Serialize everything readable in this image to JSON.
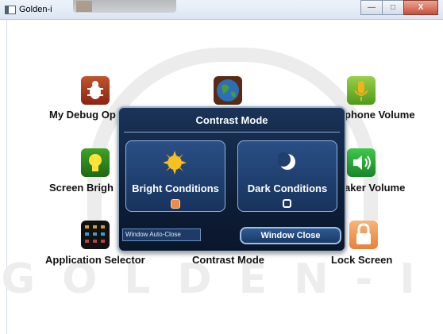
{
  "window": {
    "title": "Golden-i",
    "background_dialog_title": "Contrast Mode"
  },
  "watermark": "GOLDEN-I",
  "tiles": [
    {
      "label": "My Debug Op",
      "icon": "bug-icon"
    },
    {
      "label": "",
      "icon": "globe-icon"
    },
    {
      "label": "phone Volume",
      "icon": "microphone-icon"
    },
    {
      "label": "Screen Brigh",
      "icon": "lightbulb-icon"
    },
    {
      "label": "aker Volume",
      "icon": "speaker-icon"
    },
    {
      "label": "Application Selector",
      "icon": "app-grid-icon"
    },
    {
      "label": "Contrast Mode",
      "icon": "contrast-icon"
    },
    {
      "label": "Lock Screen",
      "icon": "lock-icon"
    }
  ],
  "dialog": {
    "title": "Contrast Mode",
    "options": [
      {
        "label": "Bright Conditions",
        "icon": "sun-icon",
        "selected": true
      },
      {
        "label": "Dark Conditions",
        "icon": "moon-icon",
        "selected": false
      }
    ],
    "auto_close_label": "Window Auto-Close",
    "close_button": "Window Close"
  },
  "colors": {
    "accent": "#f08a45",
    "dialog_bg": "#0e1f39"
  }
}
